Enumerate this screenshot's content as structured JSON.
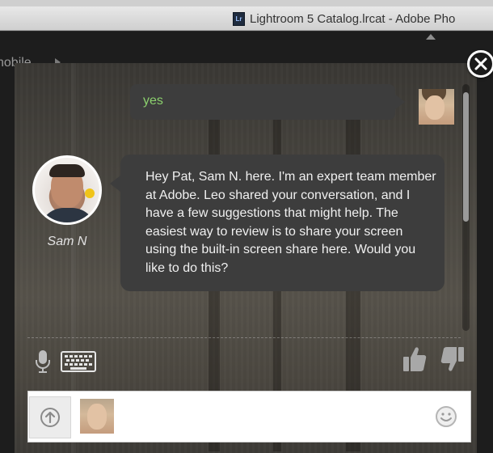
{
  "window": {
    "title": "Lightroom 5 Catalog.lrcat - Adobe Pho",
    "doc_icon_text": "Lr"
  },
  "background": {
    "side_label": "nobile"
  },
  "chat": {
    "messages": [
      {
        "from": "user",
        "text": "yes"
      },
      {
        "from": "agent",
        "name": "Sam N",
        "text": "Hey Pat, Sam N. here.  I'm an expert team member at Adobe.  Leo shared your conversation, and I have a few suggestions that might help. The easiest way to review is to share your screen using the built-in screen share here.  Would you like to do this?"
      }
    ],
    "input": {
      "value": "",
      "placeholder": ""
    }
  },
  "icons": {
    "close": "close-icon",
    "mic": "microphone-icon",
    "keyboard": "keyboard-icon",
    "thumbs_up": "thumbs-up-icon",
    "thumbs_down": "thumbs-down-icon",
    "share": "upload-icon",
    "emoji": "smiley-icon"
  },
  "colors": {
    "user_text": "#8bd06d",
    "bubble": "#3d3d3d",
    "agent_text": "#f0f0f0"
  }
}
